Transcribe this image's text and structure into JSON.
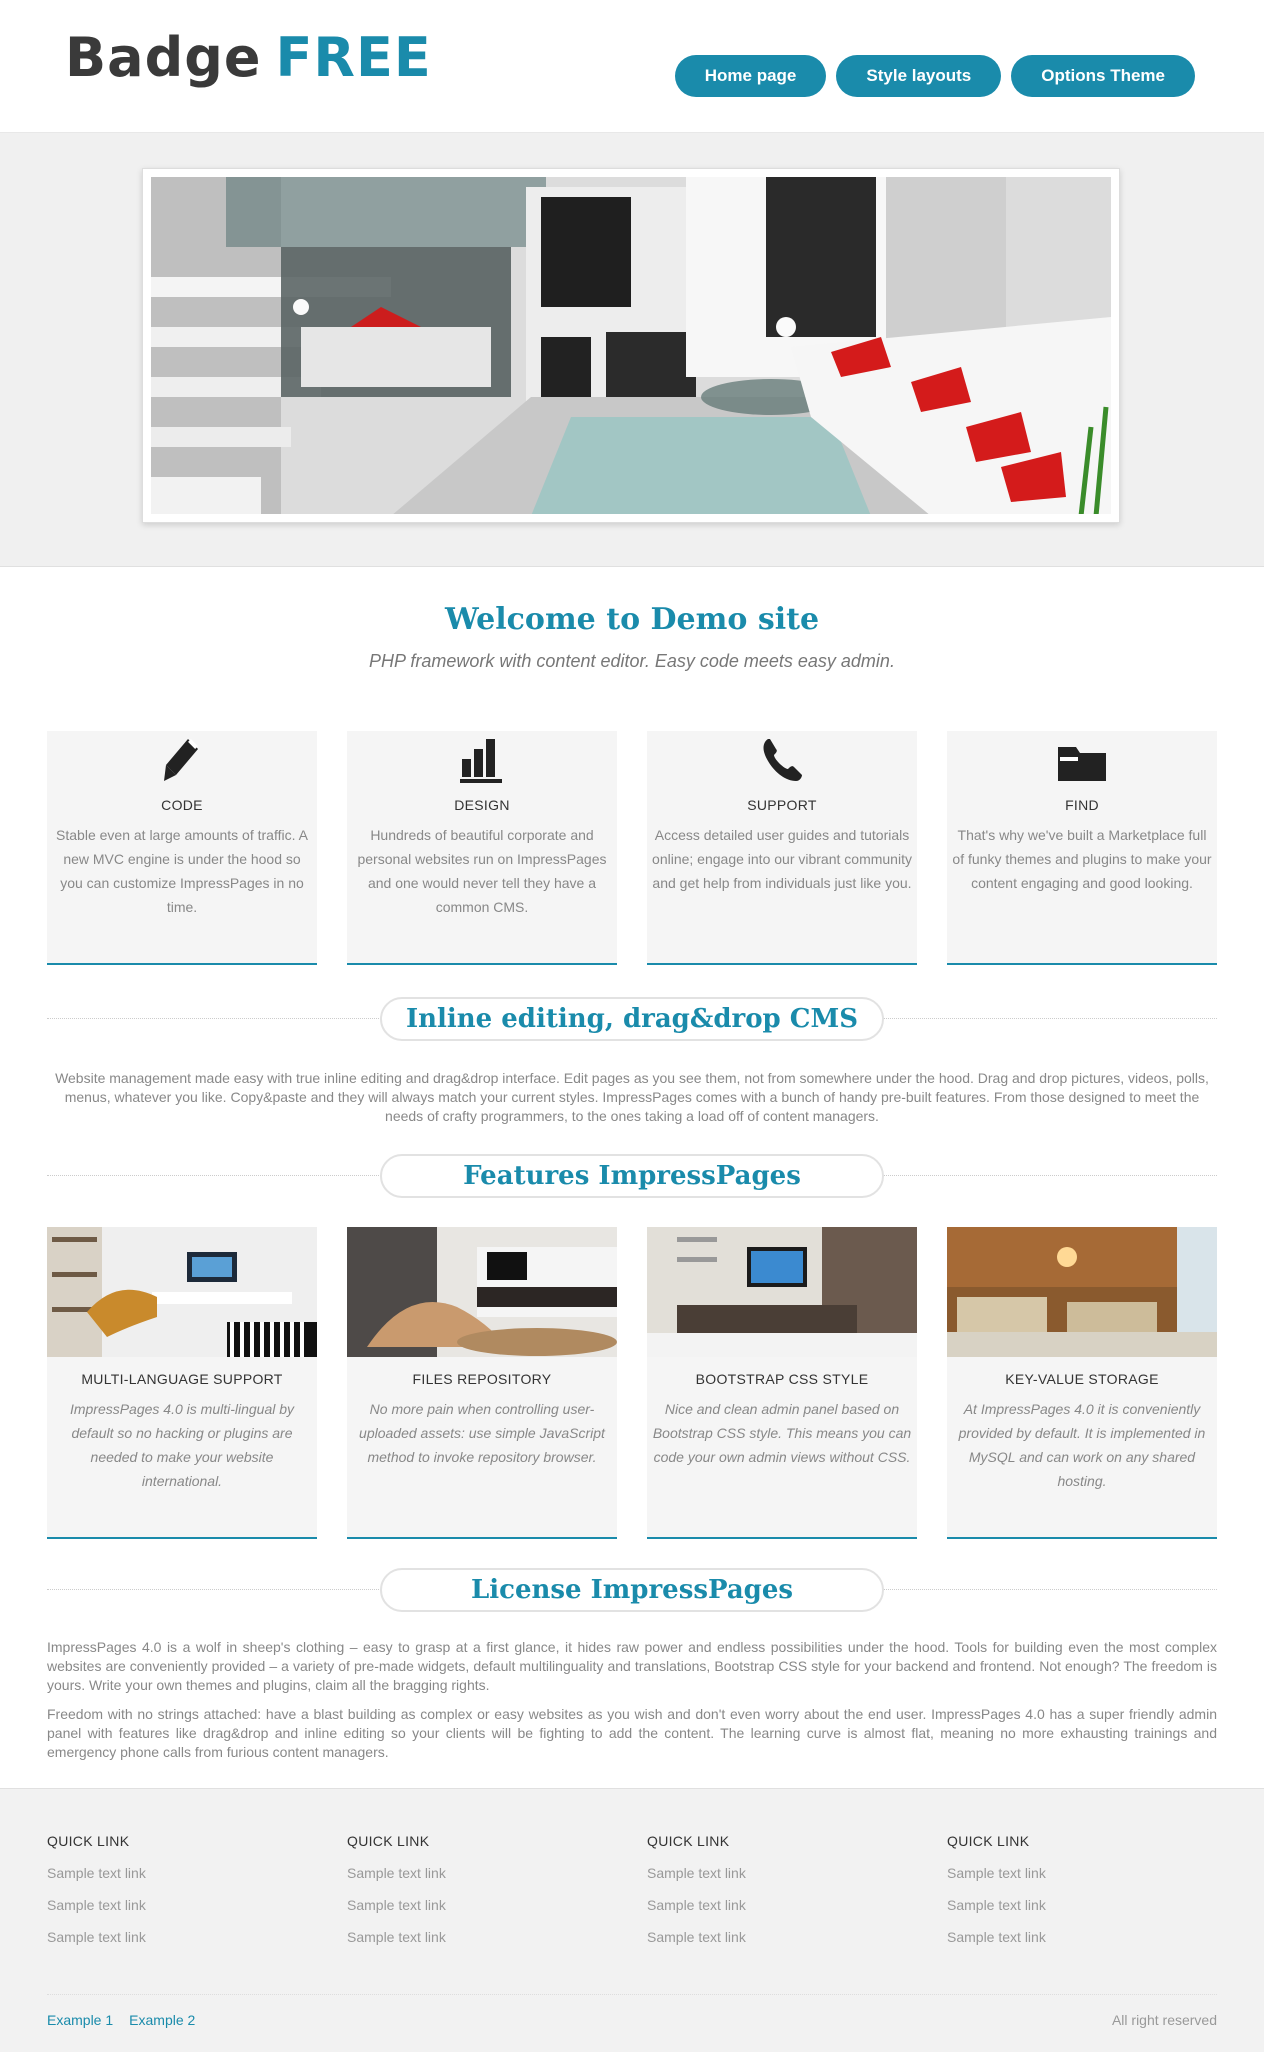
{
  "header": {
    "logo_part1": "Badge",
    "logo_part2": "FREE",
    "nav": [
      "Home page",
      "Style layouts",
      "Options Theme"
    ]
  },
  "welcome": {
    "title": "Welcome to Demo site",
    "subtitle": "PHP framework with content editor. Easy code meets easy admin."
  },
  "features": [
    {
      "title": "CODE",
      "text": "Stable even at large amounts of traffic. A new MVC engine is under the hood so you can customize ImpressPages in no time.",
      "icon": "pencil-icon"
    },
    {
      "title": "DESIGN",
      "text": "Hundreds of beautiful corporate and personal websites run on ImpressPages and one would never tell they have a common CMS.",
      "icon": "bar-chart-icon"
    },
    {
      "title": "SUPPORT",
      "text": "Access detailed user guides and tutorials online; engage into our vibrant community and get help from individuals just like you.",
      "icon": "phone-icon"
    },
    {
      "title": "FIND",
      "text": "That's why we've built a Marketplace full of funky themes and plugins to make your content engaging and good looking.",
      "icon": "folder-icon"
    }
  ],
  "inline": {
    "title": "Inline editing, drag&drop CMS",
    "text": "Website management made easy with true inline editing and drag&drop interface. Edit pages as you see them, not from somewhere under the hood. Drag and drop pictures, videos, polls, menus, whatever you like. Copy&paste and they will always match your current styles. ImpressPages comes with a bunch of handy pre-built features. From those designed to meet the needs of crafty programmers, to the ones taking a load off of content managers."
  },
  "features_impress": {
    "title": "Features ImpressPages",
    "items": [
      {
        "title": "MULTI-LANGUAGE SUPPORT",
        "text": "ImpressPages 4.0 is multi-lingual by default so no hacking or plugins are needed to make your website international."
      },
      {
        "title": "FILES REPOSITORY",
        "text": "No more pain when controlling user-uploaded assets: use simple JavaScript method to invoke repository browser."
      },
      {
        "title": "BOOTSTRAP CSS STYLE",
        "text": "Nice and clean admin panel based on Bootstrap CSS style. This means you can code your own admin views without CSS."
      },
      {
        "title": "KEY-VALUE STORAGE",
        "text": "At ImpressPages 4.0 it is conveniently provided by default. It is implemented in MySQL and can work on any shared hosting."
      }
    ]
  },
  "license": {
    "title": "License ImpressPages",
    "p1": "ImpressPages 4.0 is a wolf in sheep's clothing – easy to grasp at a first glance, it hides raw power and endless possibilities under the hood. Tools for building even the most complex websites are conveniently provided – a variety of pre-made widgets, default multilinguality and translations, Bootstrap CSS style for your backend and frontend. Not enough? The freedom is yours. Write your own themes and plugins, claim all the bragging rights.",
    "p2": "Freedom with no strings attached: have a blast building as complex or easy websites as you wish and don't even worry about the end user. ImpressPages 4.0 has a super friendly admin panel with features like drag&drop and inline editing so your clients will be fighting to add the content. The learning curve is almost flat, meaning no more exhausting trainings and emergency phone calls from furious content managers."
  },
  "footer": {
    "columns": [
      {
        "title": "QUICK LINK",
        "links": [
          "Sample text link",
          "Sample text link",
          "Sample text link"
        ]
      },
      {
        "title": "QUICK LINK",
        "links": [
          "Sample text link",
          "Sample text link",
          "Sample text link"
        ]
      },
      {
        "title": "QUICK LINK",
        "links": [
          "Sample text link",
          "Sample text link",
          "Sample text link"
        ]
      },
      {
        "title": "QUICK LINK",
        "links": [
          "Sample text link",
          "Sample text link",
          "Sample text link"
        ]
      }
    ],
    "bottom_links": [
      "Example 1",
      "Example 2"
    ],
    "copyright": "All right reserved"
  },
  "colors": {
    "accent": "#1a8bab",
    "dark": "#3a3a3a"
  }
}
